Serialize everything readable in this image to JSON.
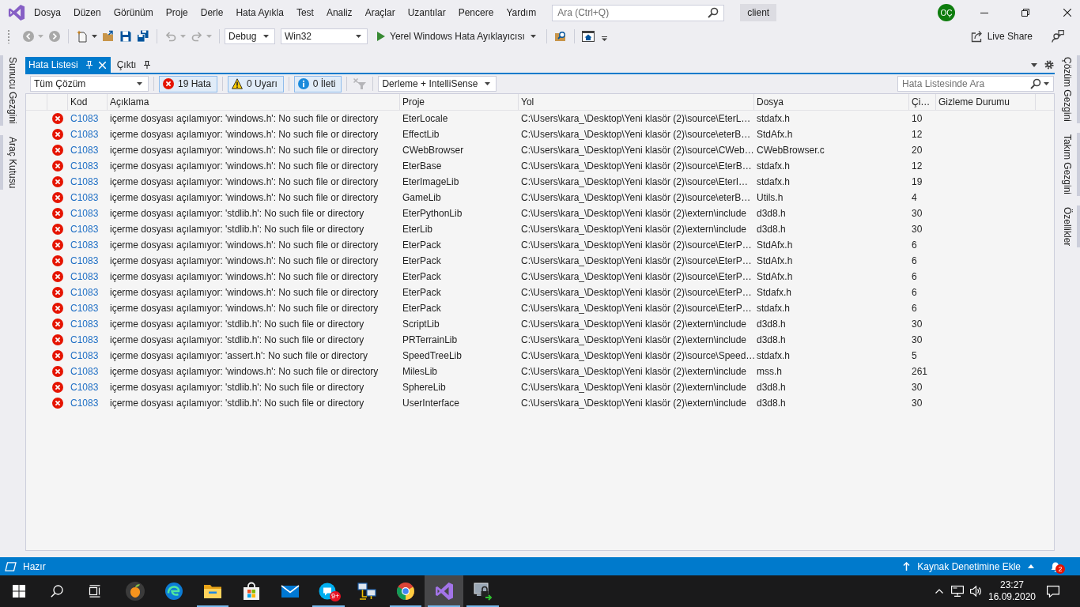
{
  "menu_bar": {
    "items": [
      "Dosya",
      "Düzen",
      "Görünüm",
      "Proje",
      "Derle",
      "Hata Ayıkla",
      "Test",
      "Analiz",
      "Araçlar",
      "Uzantılar",
      "Pencere",
      "Yardım"
    ],
    "search": {
      "placeholder": "Ara (Ctrl+Q)"
    },
    "solution_name": "client",
    "account_initials": "OÇ"
  },
  "toolbar": {
    "groups": [
      [
        {
          "kind": "back",
          "disabled": true,
          "dropdown": true
        },
        {
          "kind": "forward",
          "disabled": true,
          "dropdown": false
        }
      ],
      [
        {
          "kind": "new-project",
          "disabled": false,
          "dropdown": true
        },
        {
          "kind": "open",
          "disabled": false,
          "dropdown": false
        },
        {
          "kind": "save",
          "disabled": false,
          "dropdown": false
        },
        {
          "kind": "save-all",
          "disabled": false,
          "dropdown": false
        }
      ],
      [
        {
          "kind": "undo",
          "disabled": true,
          "dropdown": true
        },
        {
          "kind": "redo",
          "disabled": true,
          "dropdown": true
        }
      ]
    ],
    "configuration": "Debug",
    "platform": "Win32",
    "run_target": "Yerel Windows Hata Ayıklayıcısı",
    "live_share": "Live Share"
  },
  "left_panel_tabs": [
    "Sunucu Gezgini",
    "Araç Kutusu"
  ],
  "right_panel_tabs": [
    "Çözüm Gezgini",
    "Takım Gezgini",
    "Özellikler"
  ],
  "tool_window": {
    "tabs": [
      {
        "label": "Hata Listesi",
        "selected": true
      },
      {
        "label": "Çıktı",
        "selected": false
      }
    ],
    "scope": "Tüm Çözüm",
    "filters": [
      {
        "kind": "error",
        "label": "19 Hata",
        "on": true
      },
      {
        "kind": "warning",
        "label": "0 Uyarı",
        "on": true
      },
      {
        "kind": "info",
        "label": "0 İleti",
        "on": true
      }
    ],
    "clear_filter": {
      "disabled": true
    },
    "source": "Derleme + IntelliSense",
    "search": {
      "placeholder": "Hata Listesinde Ara"
    }
  },
  "table": {
    "columns": [
      "Kod",
      "Açıklama",
      "Proje",
      "Yol",
      "Dosya",
      "Çi…",
      "Gizleme Durumu"
    ],
    "rows": [
      {
        "kind": "error",
        "code": "C1083",
        "description": "içerme dosyası açılamıyor: 'windows.h': No such file or directory",
        "project": "EterLocale",
        "path": "C:\\Users\\kara_\\Desktop\\Yeni klasör (2)\\source\\EterL…",
        "file": "stdafx.h",
        "line": "10"
      },
      {
        "kind": "error",
        "code": "C1083",
        "description": "içerme dosyası açılamıyor: 'windows.h': No such file or directory",
        "project": "EffectLib",
        "path": "C:\\Users\\kara_\\Desktop\\Yeni klasör (2)\\source\\eterB…",
        "file": "StdAfx.h",
        "line": "12"
      },
      {
        "kind": "error",
        "code": "C1083",
        "description": "içerme dosyası açılamıyor: 'windows.h': No such file or directory",
        "project": "CWebBrowser",
        "path": "C:\\Users\\kara_\\Desktop\\Yeni klasör (2)\\source\\CWeb…",
        "file": "CWebBrowser.c",
        "line": "20"
      },
      {
        "kind": "error",
        "code": "C1083",
        "description": "içerme dosyası açılamıyor: 'windows.h': No such file or directory",
        "project": "EterBase",
        "path": "C:\\Users\\kara_\\Desktop\\Yeni klasör (2)\\source\\EterB…",
        "file": "stdafx.h",
        "line": "12"
      },
      {
        "kind": "error",
        "code": "C1083",
        "description": "içerme dosyası açılamıyor: 'windows.h': No such file or directory",
        "project": "EterImageLib",
        "path": "C:\\Users\\kara_\\Desktop\\Yeni klasör (2)\\source\\EterI…",
        "file": "stdafx.h",
        "line": "19"
      },
      {
        "kind": "error",
        "code": "C1083",
        "description": "içerme dosyası açılamıyor: 'windows.h': No such file or directory",
        "project": "GameLib",
        "path": "C:\\Users\\kara_\\Desktop\\Yeni klasör (2)\\source\\eterB…",
        "file": "Utils.h",
        "line": "4"
      },
      {
        "kind": "error",
        "code": "C1083",
        "description": "içerme dosyası açılamıyor: 'stdlib.h': No such file or directory",
        "project": "EterPythonLib",
        "path": "C:\\Users\\kara_\\Desktop\\Yeni klasör (2)\\extern\\include",
        "file": "d3d8.h",
        "line": "30"
      },
      {
        "kind": "error",
        "code": "C1083",
        "description": "içerme dosyası açılamıyor: 'stdlib.h': No such file or directory",
        "project": "EterLib",
        "path": "C:\\Users\\kara_\\Desktop\\Yeni klasör (2)\\extern\\include",
        "file": "d3d8.h",
        "line": "30"
      },
      {
        "kind": "error",
        "code": "C1083",
        "description": "içerme dosyası açılamıyor: 'windows.h': No such file or directory",
        "project": "EterPack",
        "path": "C:\\Users\\kara_\\Desktop\\Yeni klasör (2)\\source\\EterP…",
        "file": "StdAfx.h",
        "line": "6"
      },
      {
        "kind": "error",
        "code": "C1083",
        "description": "içerme dosyası açılamıyor: 'windows.h': No such file or directory",
        "project": "EterPack",
        "path": "C:\\Users\\kara_\\Desktop\\Yeni klasör (2)\\source\\EterP…",
        "file": "StdAfx.h",
        "line": "6"
      },
      {
        "kind": "error",
        "code": "C1083",
        "description": "içerme dosyası açılamıyor: 'windows.h': No such file or directory",
        "project": "EterPack",
        "path": "C:\\Users\\kara_\\Desktop\\Yeni klasör (2)\\source\\EterP…",
        "file": "StdAfx.h",
        "line": "6"
      },
      {
        "kind": "error",
        "code": "C1083",
        "description": "içerme dosyası açılamıyor: 'windows.h': No such file or directory",
        "project": "EterPack",
        "path": "C:\\Users\\kara_\\Desktop\\Yeni klasör (2)\\source\\EterP…",
        "file": "Stdafx.h",
        "line": "6"
      },
      {
        "kind": "error",
        "code": "C1083",
        "description": "içerme dosyası açılamıyor: 'windows.h': No such file or directory",
        "project": "EterPack",
        "path": "C:\\Users\\kara_\\Desktop\\Yeni klasör (2)\\source\\EterP…",
        "file": "stdafx.h",
        "line": "6"
      },
      {
        "kind": "error",
        "code": "C1083",
        "description": "içerme dosyası açılamıyor: 'stdlib.h': No such file or directory",
        "project": "ScriptLib",
        "path": "C:\\Users\\kara_\\Desktop\\Yeni klasör (2)\\extern\\include",
        "file": "d3d8.h",
        "line": "30"
      },
      {
        "kind": "error",
        "code": "C1083",
        "description": "içerme dosyası açılamıyor: 'stdlib.h': No such file or directory",
        "project": "PRTerrainLib",
        "path": "C:\\Users\\kara_\\Desktop\\Yeni klasör (2)\\extern\\include",
        "file": "d3d8.h",
        "line": "30"
      },
      {
        "kind": "error",
        "code": "C1083",
        "description": "içerme dosyası açılamıyor: 'assert.h': No such file or directory",
        "project": "SpeedTreeLib",
        "path": "C:\\Users\\kara_\\Desktop\\Yeni klasör (2)\\source\\Speed…",
        "file": "stdafx.h",
        "line": "5"
      },
      {
        "kind": "error",
        "code": "C1083",
        "description": "içerme dosyası açılamıyor: 'windows.h': No such file or directory",
        "project": "MilesLib",
        "path": "C:\\Users\\kara_\\Desktop\\Yeni klasör (2)\\extern\\include",
        "file": "mss.h",
        "line": "261"
      },
      {
        "kind": "error",
        "code": "C1083",
        "description": "içerme dosyası açılamıyor: 'stdlib.h': No such file or directory",
        "project": "SphereLib",
        "path": "C:\\Users\\kara_\\Desktop\\Yeni klasör (2)\\extern\\include",
        "file": "d3d8.h",
        "line": "30"
      },
      {
        "kind": "error",
        "code": "C1083",
        "description": "içerme dosyası açılamıyor: 'stdlib.h': No such file or directory",
        "project": "UserInterface",
        "path": "C:\\Users\\kara_\\Desktop\\Yeni klasör (2)\\extern\\include",
        "file": "d3d8.h",
        "line": "30"
      }
    ]
  },
  "status_bar": {
    "text": "Hazır",
    "source_control": "Kaynak Denetimine Ekle",
    "notifications": "2"
  },
  "taskbar": {
    "apps": [
      {
        "kind": "fruit",
        "selected": false,
        "running": false
      },
      {
        "kind": "swirl",
        "selected": false,
        "running": false
      },
      {
        "kind": "folder",
        "selected": false,
        "running": true
      },
      {
        "kind": "bag",
        "selected": false,
        "running": false
      },
      {
        "kind": "envelope",
        "selected": false,
        "running": false
      },
      {
        "kind": "chat",
        "selected": false,
        "running": true,
        "badge": "9+"
      },
      {
        "kind": "network",
        "selected": false,
        "running": false
      },
      {
        "kind": "circle-logo",
        "selected": false,
        "running": true
      },
      {
        "kind": "ribbon-logo",
        "selected": true,
        "running": true
      },
      {
        "kind": "padlock",
        "selected": false,
        "running": true
      }
    ],
    "time": "23:27",
    "date": "16.09.2020"
  }
}
